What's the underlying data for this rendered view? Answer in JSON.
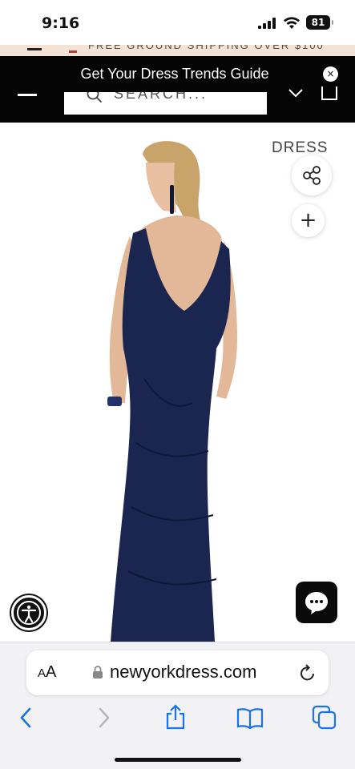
{
  "status_bar": {
    "time": "9:16",
    "battery": "81"
  },
  "promo": {
    "strip_text": "FREE GROUND SHIPPING OVER $100"
  },
  "header": {
    "banner_text": "Get Your Dress Trends Guide",
    "close_label": "×",
    "search_placeholder": "SEARCH..."
  },
  "product": {
    "category_label": "DRESS",
    "plus_label": "+",
    "dress_color": "#1a2550"
  },
  "browser": {
    "aa_small": "A",
    "aa_large": "A",
    "url": "newyorkdress.com"
  },
  "colors": {
    "accent_dark": "#050505",
    "ios_blue": "#1a73e8"
  }
}
